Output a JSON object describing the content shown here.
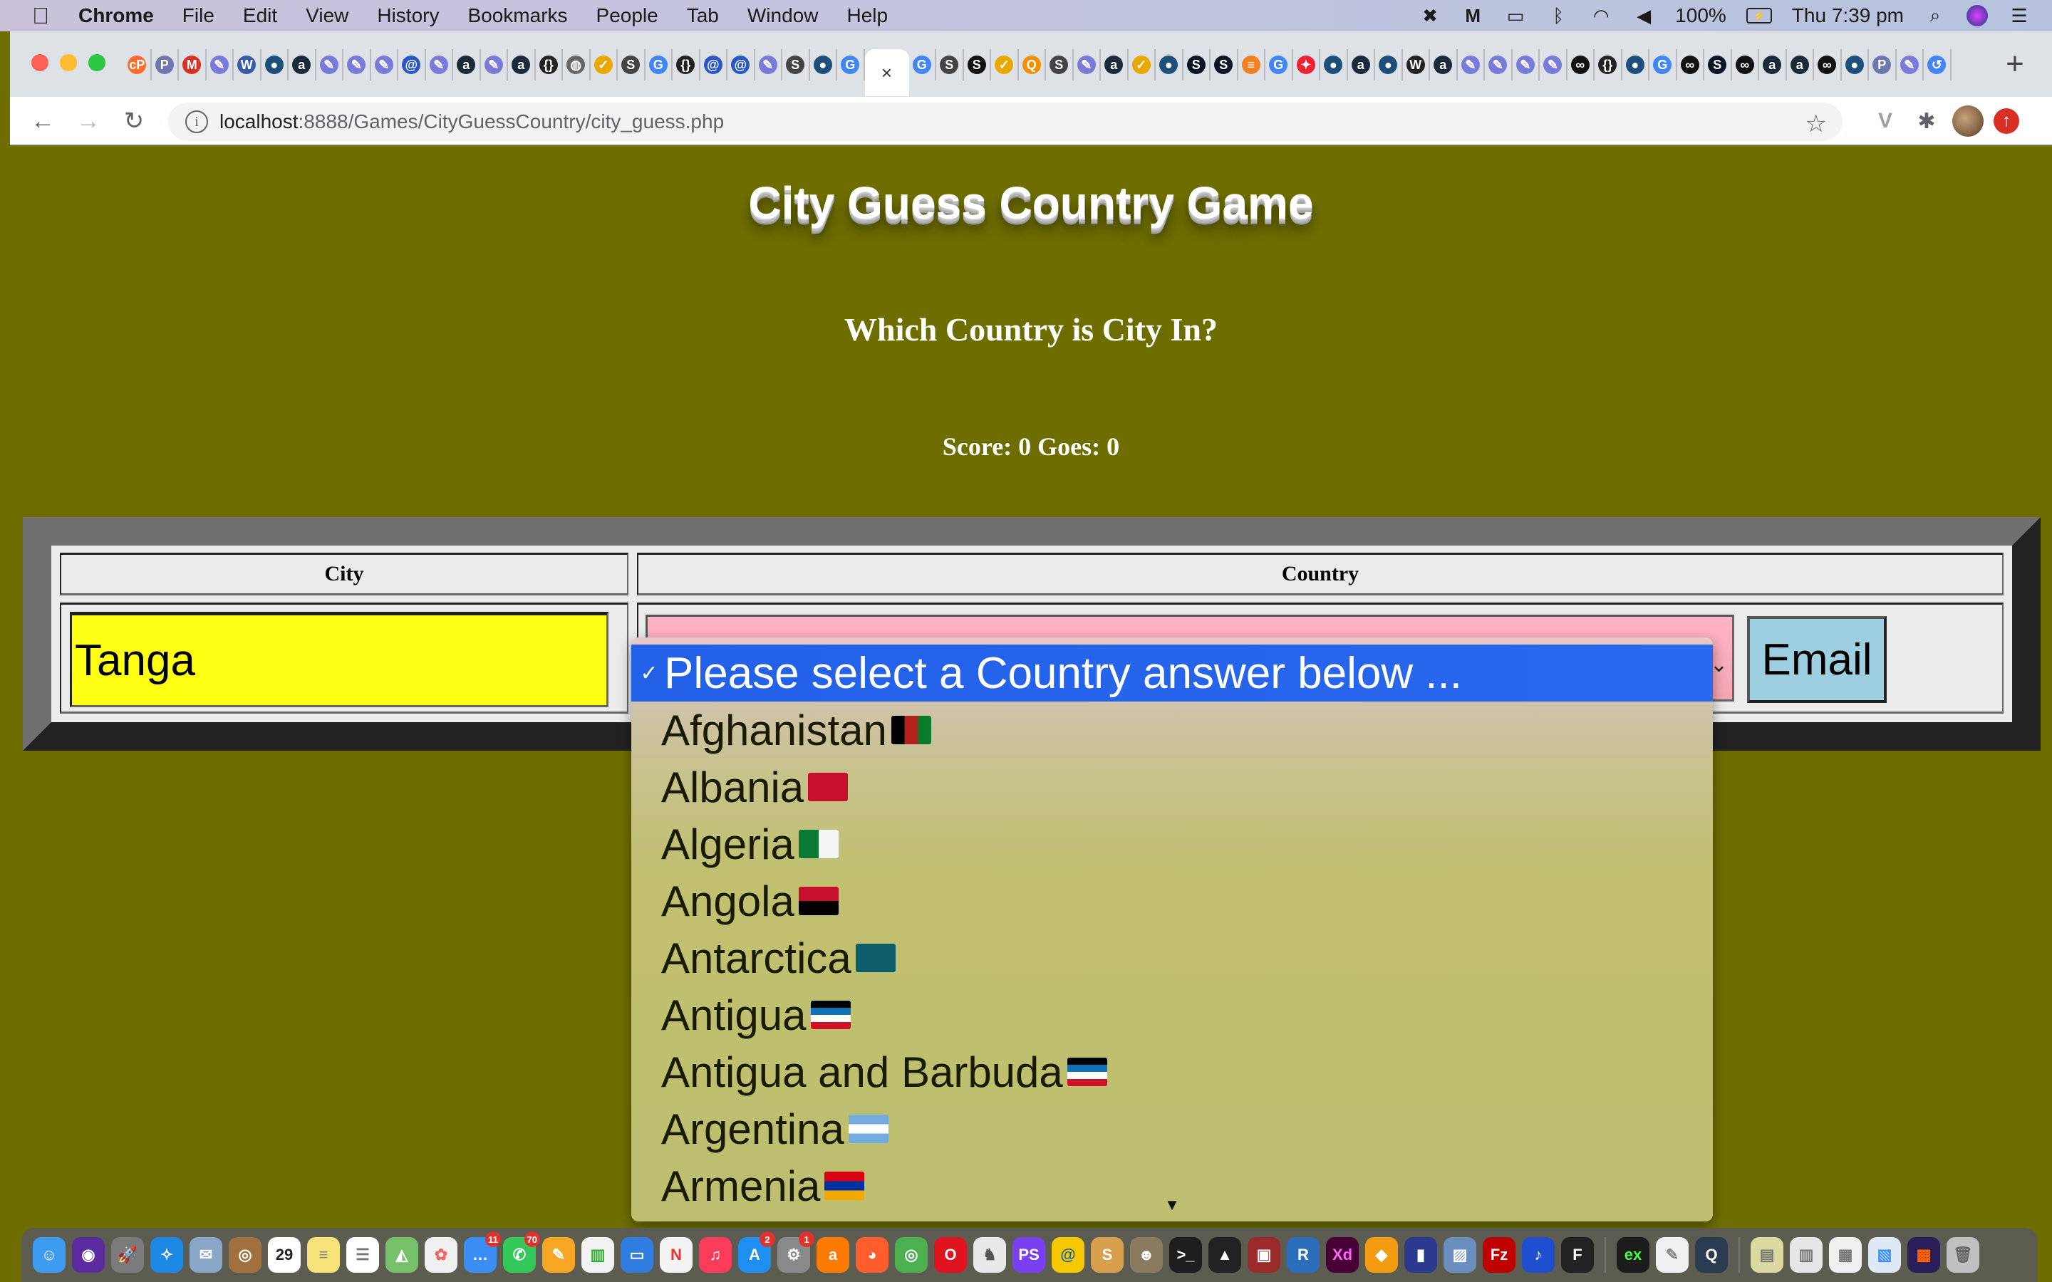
{
  "menubar": {
    "app_name": "Chrome",
    "items": [
      "File",
      "Edit",
      "View",
      "History",
      "Bookmarks",
      "People",
      "Tab",
      "Window",
      "Help"
    ],
    "battery": "100%",
    "clock": "Thu 7:39 pm"
  },
  "browser": {
    "url_host": "localhost",
    "url_rest": ":8888/Games/CityGuessCountry/city_guess.php",
    "active_tab_close": "×",
    "new_tab": "+",
    "tab_favicons": [
      {
        "icon": "cpanel-icon",
        "glyph": "cP",
        "color": "#ff6c2c"
      },
      {
        "icon": "phpmyadmin-icon",
        "glyph": "P",
        "color": "#6c78af"
      },
      {
        "icon": "gmail-icon",
        "glyph": "M",
        "color": "#d93025"
      },
      {
        "icon": "pen-icon",
        "glyph": "✎",
        "color": "#7a7ad8"
      },
      {
        "icon": "w-icon",
        "glyph": "W",
        "color": "#3a5ca8"
      },
      {
        "icon": "dot-icon",
        "glyph": "●",
        "color": "#1e4f7a"
      },
      {
        "icon": "a-icon",
        "glyph": "a",
        "color": "#1a2a3a"
      },
      {
        "icon": "pen-icon",
        "glyph": "✎",
        "color": "#7a7ad8"
      },
      {
        "icon": "pen-icon",
        "glyph": "✎",
        "color": "#7a7ad8"
      },
      {
        "icon": "pen-icon",
        "glyph": "✎",
        "color": "#7a7ad8"
      },
      {
        "icon": "at-icon",
        "glyph": "@",
        "color": "#2a56c6"
      },
      {
        "icon": "pen-icon",
        "glyph": "✎",
        "color": "#7a7ad8"
      },
      {
        "icon": "a-icon",
        "glyph": "a",
        "color": "#1a2a3a"
      },
      {
        "icon": "pen-icon",
        "glyph": "✎",
        "color": "#7a7ad8"
      },
      {
        "icon": "a-icon",
        "glyph": "a",
        "color": "#1a2a3a"
      },
      {
        "icon": "braces-icon",
        "glyph": "{}",
        "color": "#222"
      },
      {
        "icon": "elephant-icon",
        "glyph": "◍",
        "color": "#666"
      },
      {
        "icon": "check-icon",
        "glyph": "✓",
        "color": "#e8a800"
      },
      {
        "icon": "s-icon",
        "glyph": "S",
        "color": "#444"
      },
      {
        "icon": "translate-icon",
        "glyph": "G",
        "color": "#4285f4"
      },
      {
        "icon": "braces-icon",
        "glyph": "{}",
        "color": "#222"
      },
      {
        "icon": "at-icon",
        "glyph": "@",
        "color": "#2a56c6"
      },
      {
        "icon": "at-icon",
        "glyph": "@",
        "color": "#2a56c6"
      },
      {
        "icon": "pen-icon",
        "glyph": "✎",
        "color": "#7a7ad8"
      },
      {
        "icon": "s-icon",
        "glyph": "S",
        "color": "#444"
      },
      {
        "icon": "dot-icon",
        "glyph": "●",
        "color": "#1e4f7a"
      },
      {
        "icon": "google-icon",
        "glyph": "G",
        "color": "#4285f4"
      },
      {
        "icon": "google-icon",
        "glyph": "G",
        "color": "#4285f4"
      },
      {
        "icon": "s-icon",
        "glyph": "S",
        "color": "#444"
      },
      {
        "icon": "sp-icon",
        "glyph": "S",
        "color": "#111"
      },
      {
        "icon": "check-icon",
        "glyph": "✓",
        "color": "#e8a800"
      },
      {
        "icon": "search-icon",
        "glyph": "Q",
        "color": "#f29100"
      },
      {
        "icon": "s-icon",
        "glyph": "S",
        "color": "#444"
      },
      {
        "icon": "pen-icon",
        "glyph": "✎",
        "color": "#7a7ad8"
      },
      {
        "icon": "a-icon",
        "glyph": "a",
        "color": "#1a2a3a"
      },
      {
        "icon": "check-icon",
        "glyph": "✓",
        "color": "#e8a800"
      },
      {
        "icon": "dot-icon",
        "glyph": "●",
        "color": "#1e4f7a"
      },
      {
        "icon": "times-icon",
        "glyph": "S",
        "color": "#0a1628"
      },
      {
        "icon": "times-icon",
        "glyph": "S",
        "color": "#0a1628"
      },
      {
        "icon": "stackoverflow-icon",
        "glyph": "≡",
        "color": "#f48024"
      },
      {
        "icon": "translate-icon",
        "glyph": "G",
        "color": "#4285f4"
      },
      {
        "icon": "nbc-icon",
        "glyph": "✦",
        "color": "#e23"
      },
      {
        "icon": "dot-icon",
        "glyph": "●",
        "color": "#1e4f7a"
      },
      {
        "icon": "a-icon",
        "glyph": "a",
        "color": "#1a2a3a"
      },
      {
        "icon": "dot-icon",
        "glyph": "●",
        "color": "#1e4f7a"
      },
      {
        "icon": "w-icon",
        "glyph": "W",
        "color": "#222"
      },
      {
        "icon": "a-icon",
        "glyph": "a",
        "color": "#1a2a3a"
      },
      {
        "icon": "pen-icon",
        "glyph": "✎",
        "color": "#7a7ad8"
      },
      {
        "icon": "pen-icon",
        "glyph": "✎",
        "color": "#7a7ad8"
      },
      {
        "icon": "pen-icon",
        "glyph": "✎",
        "color": "#7a7ad8"
      },
      {
        "icon": "pen-icon",
        "glyph": "✎",
        "color": "#7a7ad8"
      },
      {
        "icon": "abc-icon",
        "glyph": "∞",
        "color": "#111"
      },
      {
        "icon": "braces-icon",
        "glyph": "{}",
        "color": "#222"
      },
      {
        "icon": "dot-icon",
        "glyph": "●",
        "color": "#1e4f7a"
      },
      {
        "icon": "google-icon",
        "glyph": "G",
        "color": "#4285f4"
      },
      {
        "icon": "abc-icon",
        "glyph": "∞",
        "color": "#111"
      },
      {
        "icon": "times-icon",
        "glyph": "S",
        "color": "#0a1628"
      },
      {
        "icon": "abc-icon",
        "glyph": "∞",
        "color": "#111"
      },
      {
        "icon": "a-icon",
        "glyph": "a",
        "color": "#1a2a3a"
      },
      {
        "icon": "a-icon",
        "glyph": "a",
        "color": "#1a2a3a"
      },
      {
        "icon": "abc-icon",
        "glyph": "∞",
        "color": "#111"
      },
      {
        "icon": "dot-icon",
        "glyph": "●",
        "color": "#1e4f7a"
      },
      {
        "icon": "phpmyadmin-icon",
        "glyph": "P",
        "color": "#6c78af"
      },
      {
        "icon": "pen-icon",
        "glyph": "✎",
        "color": "#7a7ad8"
      },
      {
        "icon": "history-icon",
        "glyph": "↺",
        "color": "#4285f4"
      }
    ]
  },
  "page": {
    "title": "City Guess Country Game",
    "subtitle": "Which Country is City In?",
    "score_text": "Score: 0 Goes: 0",
    "table": {
      "headers": [
        "City",
        "Country"
      ],
      "city_value": "Tanga",
      "email_label": "Email"
    },
    "colors": {
      "page_bg": "#6e6e00",
      "city_input_bg": "#ffff13",
      "select_bg": "#ffb3c4",
      "email_bg": "#9ecfe0",
      "dropdown_highlight": "#2260e8"
    }
  },
  "dropdown": {
    "selected_label": "Please select a Country answer below ...",
    "check": "✓",
    "options": [
      {
        "label": "Afghanistan",
        "flag": [
          "#000000",
          "#b0211f",
          "#0a7a2b"
        ],
        "flag_dir": "v"
      },
      {
        "label": "Albania",
        "flag": [
          "#c8102e",
          "#c8102e",
          "#c8102e"
        ],
        "flag_dir": "v"
      },
      {
        "label": "Algeria",
        "flag": [
          "#0b7a34",
          "#f4f4f4"
        ],
        "flag_dir": "v"
      },
      {
        "label": "Angola",
        "flag": [
          "#c8102e",
          "#000000"
        ],
        "flag_dir": "h"
      },
      {
        "label": "Antarctica",
        "flag": [
          "#0e5d6b",
          "#0e5d6b"
        ],
        "flag_dir": "h"
      },
      {
        "label": "Antigua",
        "flag": [
          "#000000",
          "#0e72b5",
          "#ffffff",
          "#ce1126"
        ],
        "flag_dir": "h"
      },
      {
        "label": "Antigua and Barbuda",
        "flag": [
          "#000000",
          "#0e72b5",
          "#ffffff",
          "#ce1126"
        ],
        "flag_dir": "h"
      },
      {
        "label": "Argentina",
        "flag": [
          "#74acdf",
          "#ffffff",
          "#74acdf"
        ],
        "flag_dir": "h"
      },
      {
        "label": "Armenia",
        "flag": [
          "#d90012",
          "#0033a0",
          "#f2a800"
        ],
        "flag_dir": "h"
      }
    ],
    "scroll_down": "▼"
  },
  "dock": {
    "apps": [
      {
        "name": "finder",
        "glyph": "☺",
        "color": "#3d9bf0"
      },
      {
        "name": "siri",
        "glyph": "◉",
        "color": "#5b2ca0"
      },
      {
        "name": "launchpad",
        "glyph": "🚀",
        "color": "#7b7b7b"
      },
      {
        "name": "safari",
        "glyph": "✧",
        "color": "#1e88e5"
      },
      {
        "name": "mail",
        "glyph": "✉",
        "color": "#8aa7c9"
      },
      {
        "name": "contacts",
        "glyph": "◎",
        "color": "#a0713e"
      },
      {
        "name": "calendar",
        "glyph": "29",
        "color": "#ffffff",
        "text_color": "#222"
      },
      {
        "name": "notes",
        "glyph": "≡",
        "color": "#f7e27a",
        "text_color": "#888"
      },
      {
        "name": "reminders",
        "glyph": "☰",
        "color": "#ffffff",
        "text_color": "#777"
      },
      {
        "name": "maps",
        "glyph": "◭",
        "color": "#76c06a"
      },
      {
        "name": "photos",
        "glyph": "✿",
        "color": "#f0f0f0",
        "text_color": "#e66"
      },
      {
        "name": "messages",
        "glyph": "…",
        "color": "#3a8ef6",
        "badge": "11"
      },
      {
        "name": "facetime",
        "glyph": "✆",
        "color": "#34c759",
        "badge": "70"
      },
      {
        "name": "pages",
        "glyph": "✎",
        "color": "#f5a623"
      },
      {
        "name": "numbers",
        "glyph": "▥",
        "color": "#f2f2f2",
        "text_color": "#3a3"
      },
      {
        "name": "keynote",
        "glyph": "▭",
        "color": "#2f7de1"
      },
      {
        "name": "news",
        "glyph": "N",
        "color": "#f3f3f3",
        "text_color": "#e33"
      },
      {
        "name": "music",
        "glyph": "♫",
        "color": "#fa3c5a"
      },
      {
        "name": "app-store",
        "glyph": "A",
        "color": "#1f8ef1",
        "badge": "2"
      },
      {
        "name": "system-preferences",
        "glyph": "⚙",
        "color": "#8a8a8a",
        "badge": "1"
      },
      {
        "name": "avast",
        "glyph": "a",
        "color": "#ff7a00"
      },
      {
        "name": "firefox",
        "glyph": "◕",
        "color": "#ff5e2c"
      },
      {
        "name": "chrome",
        "glyph": "◎",
        "color": "#4caf50"
      },
      {
        "name": "opera",
        "glyph": "O",
        "color": "#e0141e"
      },
      {
        "name": "sequel-pro",
        "glyph": "♞",
        "color": "#e8e8e8",
        "text_color": "#555"
      },
      {
        "name": "phpstorm",
        "glyph": "PS",
        "color": "#7b3ff2"
      },
      {
        "name": "cyberduck",
        "glyph": "@",
        "color": "#f5c800",
        "text_color": "#1a5fb4"
      },
      {
        "name": "sublime",
        "glyph": "S",
        "color": "#d8a04c"
      },
      {
        "name": "gimp",
        "glyph": "☻",
        "color": "#8a7a60"
      },
      {
        "name": "terminal",
        "glyph": ">_",
        "color": "#1e1e1e"
      },
      {
        "name": "inkscape",
        "glyph": "▲",
        "color": "#222"
      },
      {
        "name": "photo-booth",
        "glyph": "▣",
        "color": "#9b2a2a"
      },
      {
        "name": "r",
        "glyph": "R",
        "color": "#2a6ebb"
      },
      {
        "name": "adobe-xd",
        "glyph": "Xd",
        "color": "#470137",
        "text_color": "#ff61f6"
      },
      {
        "name": "sketch-like",
        "glyph": "◆",
        "color": "#f39c12"
      },
      {
        "name": "word",
        "glyph": "▮",
        "color": "#2b3a8f"
      },
      {
        "name": "preview",
        "glyph": "▨",
        "color": "#6a8fbf"
      },
      {
        "name": "filezilla",
        "glyph": "Fz",
        "color": "#bf0000"
      },
      {
        "name": "audacity",
        "glyph": "♪",
        "color": "#1f4fcf"
      },
      {
        "name": "f-app",
        "glyph": "F",
        "color": "#222"
      },
      {
        "name": "sep",
        "glyph": "",
        "color": ""
      },
      {
        "name": "console",
        "glyph": "ex",
        "color": "#1c1c1c",
        "text_color": "#4f4"
      },
      {
        "name": "textedit",
        "glyph": "✎",
        "color": "#f0f0f0",
        "text_color": "#888"
      },
      {
        "name": "quicktime",
        "glyph": "Q",
        "color": "#2b3b52"
      },
      {
        "name": "sep",
        "glyph": "",
        "color": ""
      },
      {
        "name": "downloads",
        "glyph": "▤",
        "color": "#d9d9a0",
        "text_color": "#777"
      },
      {
        "name": "window-1",
        "glyph": "▥",
        "color": "#e6e6e6",
        "text_color": "#777"
      },
      {
        "name": "window-2",
        "glyph": "▦",
        "color": "#f0f0f0",
        "text_color": "#777"
      },
      {
        "name": "window-3",
        "glyph": "▧",
        "color": "#dfe8f5",
        "text_color": "#3a8ef6"
      },
      {
        "name": "window-4",
        "glyph": "▩",
        "color": "#2b1d5a",
        "text_color": "#f60"
      },
      {
        "name": "trash",
        "glyph": "🗑",
        "color": "#c0c0c0",
        "text_color": "#666"
      }
    ]
  }
}
